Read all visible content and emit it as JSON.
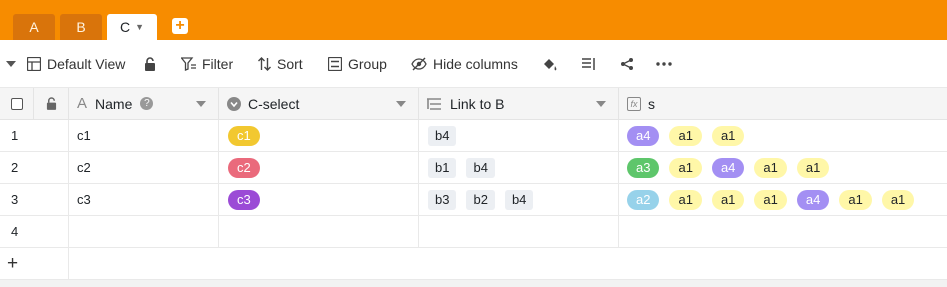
{
  "tabs": [
    {
      "label": "A",
      "active": false
    },
    {
      "label": "B",
      "active": false
    },
    {
      "label": "C",
      "active": true
    }
  ],
  "toolbar": {
    "view_label": "Default View",
    "filter_label": "Filter",
    "sort_label": "Sort",
    "group_label": "Group",
    "hide_columns_label": "Hide columns"
  },
  "columns": {
    "name": "Name",
    "cselect": "C-select",
    "link": "Link to B",
    "formula": "s"
  },
  "rows": [
    {
      "num": "1",
      "name": "c1",
      "cselect": {
        "label": "c1",
        "color": "#f2c830"
      },
      "links": [
        "b4"
      ],
      "formula": [
        {
          "v": "a4",
          "c": "#a38ff3",
          "t": "#fff"
        },
        {
          "v": "a1",
          "c": "#fff7a8",
          "t": "#212529"
        },
        {
          "v": "a1",
          "c": "#fff7a8",
          "t": "#212529"
        }
      ]
    },
    {
      "num": "2",
      "name": "c2",
      "cselect": {
        "label": "c2",
        "color": "#ea6a7c"
      },
      "links": [
        "b1",
        "b4"
      ],
      "formula": [
        {
          "v": "a3",
          "c": "#5ec66b",
          "t": "#fff"
        },
        {
          "v": "a1",
          "c": "#fff7a8",
          "t": "#212529"
        },
        {
          "v": "a4",
          "c": "#a38ff3",
          "t": "#fff"
        },
        {
          "v": "a1",
          "c": "#fff7a8",
          "t": "#212529"
        },
        {
          "v": "a1",
          "c": "#fff7a8",
          "t": "#212529"
        }
      ]
    },
    {
      "num": "3",
      "name": "c3",
      "cselect": {
        "label": "c3",
        "color": "#9b4bd6"
      },
      "links": [
        "b3",
        "b2",
        "b4"
      ],
      "formula": [
        {
          "v": "a2",
          "c": "#97d2ea",
          "t": "#fff"
        },
        {
          "v": "a1",
          "c": "#fff7a8",
          "t": "#212529"
        },
        {
          "v": "a1",
          "c": "#fff7a8",
          "t": "#212529"
        },
        {
          "v": "a1",
          "c": "#fff7a8",
          "t": "#212529"
        },
        {
          "v": "a4",
          "c": "#a38ff3",
          "t": "#fff"
        },
        {
          "v": "a1",
          "c": "#fff7a8",
          "t": "#212529"
        },
        {
          "v": "a1",
          "c": "#fff7a8",
          "t": "#212529"
        }
      ]
    },
    {
      "num": "4",
      "name": "",
      "cselect": null,
      "links": [],
      "formula": []
    }
  ],
  "add_row_label": "+",
  "colors": {
    "tabbar": "#f78c00",
    "accent": "#f78c00"
  }
}
